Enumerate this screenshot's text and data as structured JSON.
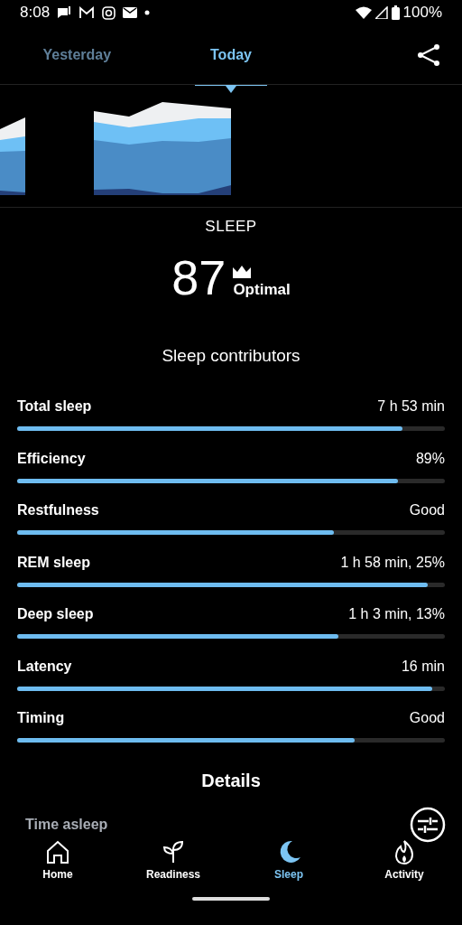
{
  "status_bar": {
    "time": "8:08",
    "battery": "100%"
  },
  "tabs": [
    {
      "label": "Yesterday",
      "selected": false
    },
    {
      "label": "Today",
      "selected": true
    }
  ],
  "score": {
    "title": "SLEEP",
    "value": "87",
    "rating": "Optimal"
  },
  "contributors": {
    "title": "Sleep contributors",
    "items": [
      {
        "name": "Total sleep",
        "reading": "7 h 53 min",
        "level": 0.9
      },
      {
        "name": "Efficiency",
        "reading": "89%",
        "level": 0.89
      },
      {
        "name": "Restfulness",
        "reading": "Good",
        "level": 0.74
      },
      {
        "name": "REM sleep",
        "reading": "1 h 58 min, 25%",
        "level": 0.96
      },
      {
        "name": "Deep sleep",
        "reading": "1 h 3 min, 13%",
        "level": 0.75
      },
      {
        "name": "Latency",
        "reading": "16 min",
        "level": 0.97
      },
      {
        "name": "Timing",
        "reading": "Good",
        "level": 0.79
      }
    ]
  },
  "details": {
    "title": "Details",
    "first_item": "Time asleep"
  },
  "bottom_nav": [
    {
      "label": "Home",
      "selected": false
    },
    {
      "label": "Readiness",
      "selected": false
    },
    {
      "label": "Sleep",
      "selected": true
    },
    {
      "label": "Activity",
      "selected": false
    }
  ]
}
